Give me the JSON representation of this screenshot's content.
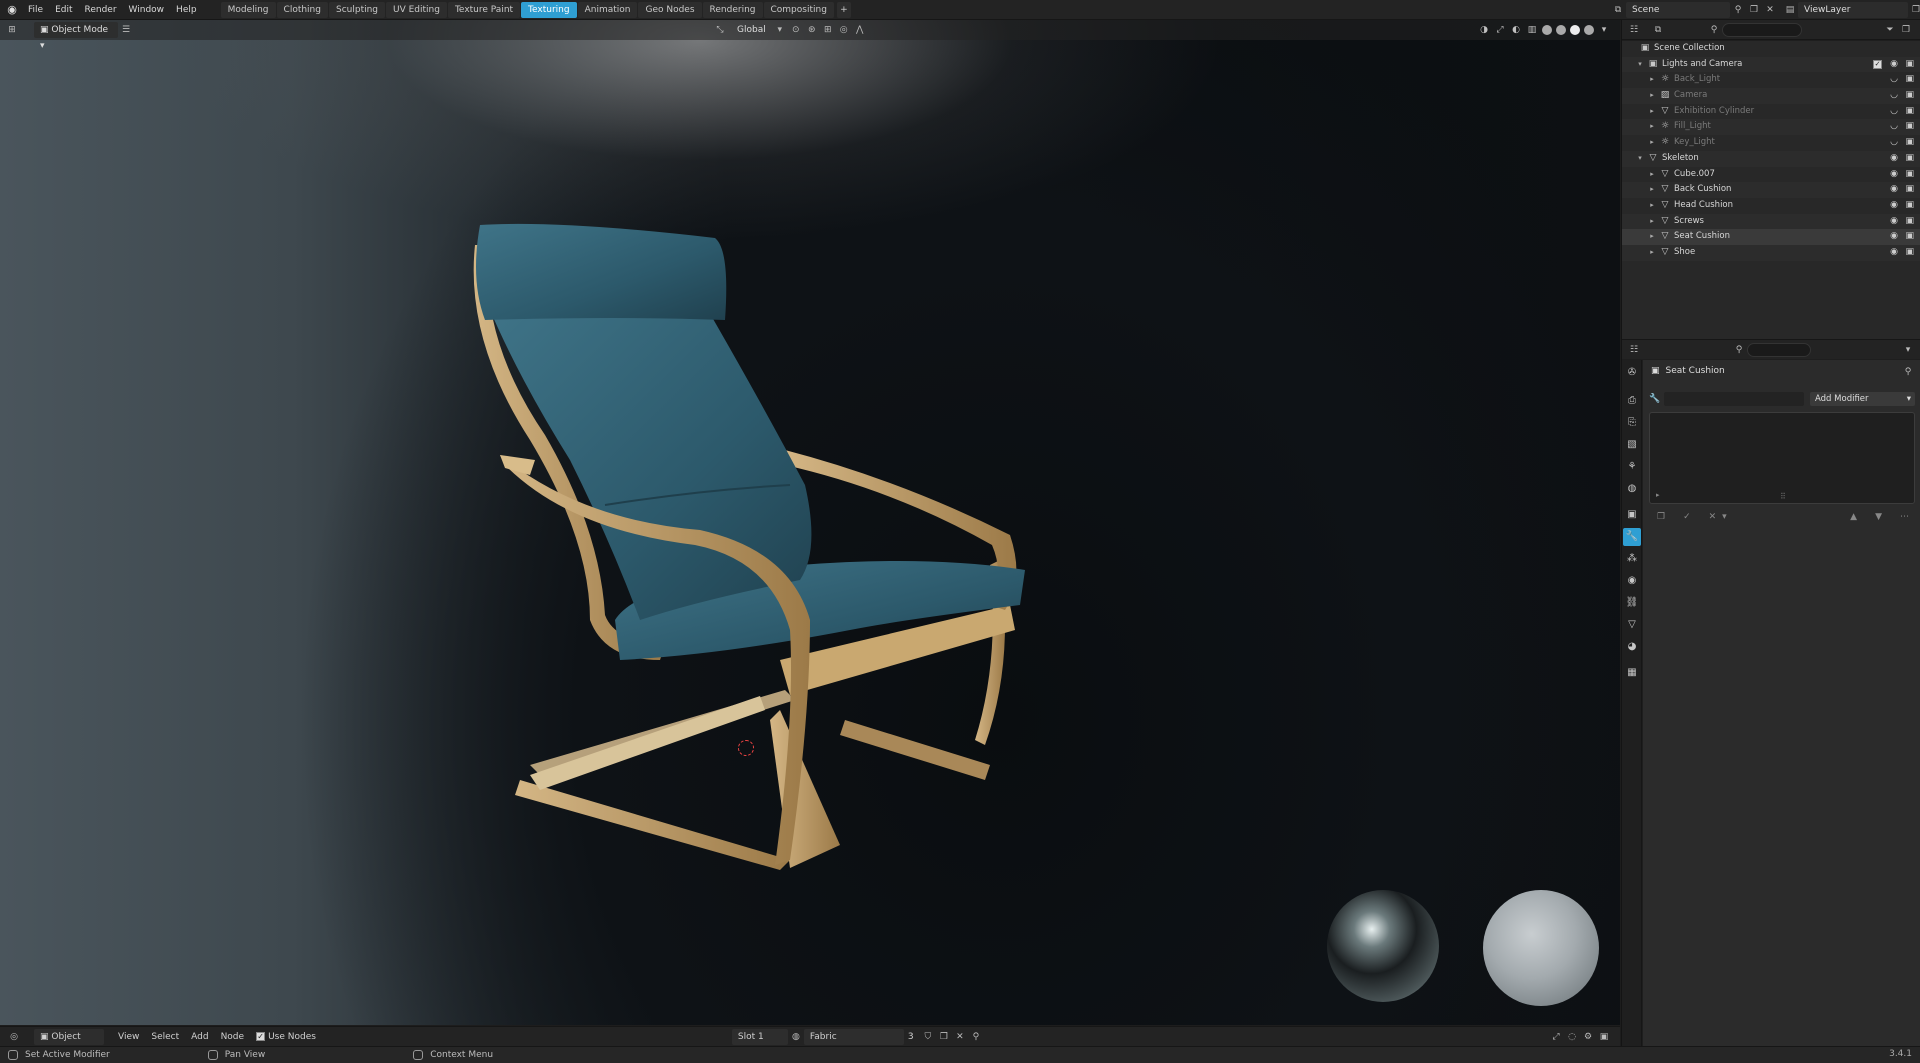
{
  "menu": [
    "File",
    "Edit",
    "Render",
    "Window",
    "Help"
  ],
  "workspaces": [
    {
      "label": "Modeling",
      "active": false
    },
    {
      "label": "Clothing",
      "active": false
    },
    {
      "label": "Sculpting",
      "active": false
    },
    {
      "label": "UV Editing",
      "active": false
    },
    {
      "label": "Texture Paint",
      "active": false
    },
    {
      "label": "Texturing",
      "active": true
    },
    {
      "label": "Animation",
      "active": false
    },
    {
      "label": "Geo Nodes",
      "active": false
    },
    {
      "label": "Rendering",
      "active": false
    },
    {
      "label": "Compositing",
      "active": false
    }
  ],
  "scene": {
    "name": "Scene",
    "view_layer": "ViewLayer"
  },
  "viewport": {
    "mode": "Object Mode",
    "orientation": "Global"
  },
  "outliner": {
    "root": "Scene Collection",
    "rows": [
      {
        "label": "Lights and Camera",
        "indent": 1,
        "expanded": true,
        "icon": "collection-icon",
        "dim": false,
        "checkbox": true
      },
      {
        "label": "Back_Light",
        "indent": 2,
        "icon": "light-icon",
        "dim": true
      },
      {
        "label": "Camera",
        "indent": 2,
        "icon": "camera-icon",
        "dim": true
      },
      {
        "label": "Exhibition Cylinder",
        "indent": 2,
        "icon": "mesh-icon",
        "dim": true
      },
      {
        "label": "Fill_Light",
        "indent": 2,
        "icon": "light-icon",
        "dim": true
      },
      {
        "label": "Key_Light",
        "indent": 2,
        "icon": "light-icon",
        "dim": true
      },
      {
        "label": "Skeleton",
        "indent": 1,
        "expanded": true,
        "icon": "mesh-icon",
        "dim": false
      },
      {
        "label": "Cube.007",
        "indent": 2,
        "icon": "mesh-icon",
        "dim": false
      },
      {
        "label": "Back Cushion",
        "indent": 2,
        "icon": "mesh-icon",
        "dim": false
      },
      {
        "label": "Head Cushion",
        "indent": 2,
        "icon": "mesh-icon",
        "dim": false
      },
      {
        "label": "Screws",
        "indent": 2,
        "icon": "mesh-icon",
        "dim": false
      },
      {
        "label": "Seat Cushion",
        "indent": 2,
        "icon": "mesh-icon",
        "dim": false,
        "selected": true
      },
      {
        "label": "Shoe",
        "indent": 2,
        "icon": "mesh-icon",
        "dim": false
      }
    ]
  },
  "properties": {
    "object_name": "Seat Cushion",
    "add_modifier": "Add Modifier"
  },
  "node_header": {
    "object": "Object",
    "view": "View",
    "select": "Select",
    "add": "Add",
    "node": "Node",
    "use_nodes": "Use Nodes",
    "slot": "Slot 1",
    "material": "Fabric",
    "users": "3"
  },
  "status": {
    "left": "Set Active Modifier",
    "middle": "Pan View",
    "right": "Context Menu",
    "version": "3.4.1"
  },
  "colors": {
    "accent": "#2f9fd3",
    "cushion": "#2f5f72",
    "wood": "#b8955f"
  }
}
